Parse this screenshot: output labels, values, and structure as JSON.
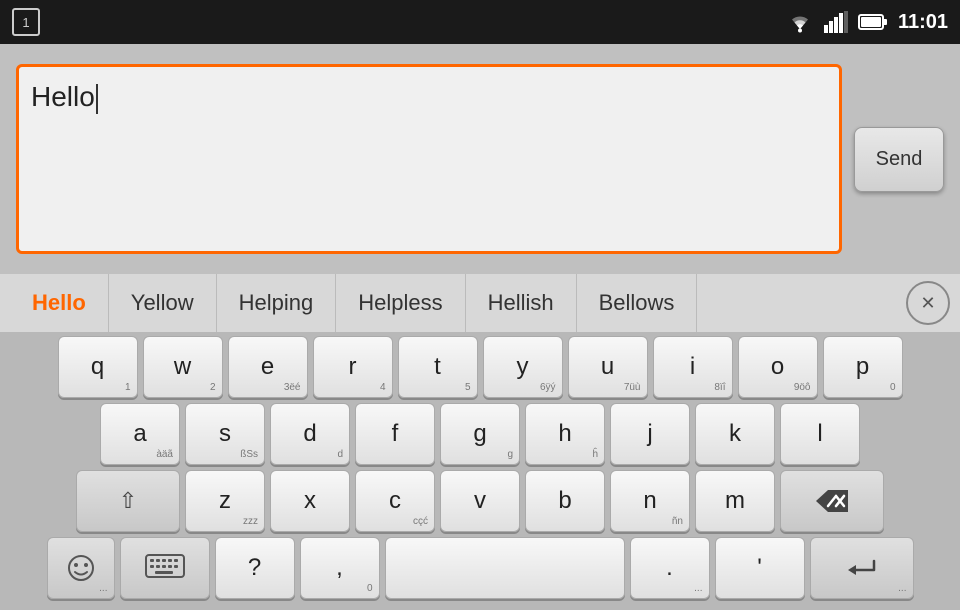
{
  "statusBar": {
    "notificationNum": "1",
    "time": "11:01"
  },
  "textInput": {
    "value": "Hello",
    "placeholder": ""
  },
  "sendButton": {
    "label": "Send"
  },
  "suggestions": [
    {
      "id": "hello",
      "label": "Hello",
      "active": true
    },
    {
      "id": "yellow",
      "label": "Yellow",
      "active": false
    },
    {
      "id": "helping",
      "label": "Helping",
      "active": false
    },
    {
      "id": "helpless",
      "label": "Helpless",
      "active": false
    },
    {
      "id": "hellish",
      "label": "Hellish",
      "active": false
    },
    {
      "id": "bellows",
      "label": "Bellows",
      "active": false
    }
  ],
  "keyboard": {
    "rows": [
      [
        {
          "main": "q",
          "sub": "1"
        },
        {
          "main": "w",
          "sub": "2"
        },
        {
          "main": "e",
          "sub": "3ëé"
        },
        {
          "main": "r",
          "sub": "4"
        },
        {
          "main": "t",
          "sub": "5"
        },
        {
          "main": "y",
          "sub": "6ÿý"
        },
        {
          "main": "u",
          "sub": "7üù"
        },
        {
          "main": "i",
          "sub": "8ïî"
        },
        {
          "main": "o",
          "sub": "9öô"
        },
        {
          "main": "p",
          "sub": "0"
        }
      ],
      [
        {
          "main": "a",
          "sub": "àäã"
        },
        {
          "main": "s",
          "sub": "ßSs"
        },
        {
          "main": "d",
          "sub": "d"
        },
        {
          "main": "f",
          "sub": ""
        },
        {
          "main": "g",
          "sub": "g"
        },
        {
          "main": "h",
          "sub": "h"
        },
        {
          "main": "j",
          "sub": ""
        },
        {
          "main": "k",
          "sub": ""
        },
        {
          "main": "l",
          "sub": ""
        }
      ],
      [
        {
          "main": "shift",
          "sub": ""
        },
        {
          "main": "z",
          "sub": "zzz"
        },
        {
          "main": "x",
          "sub": ""
        },
        {
          "main": "c",
          "sub": "cçć"
        },
        {
          "main": "v",
          "sub": ""
        },
        {
          "main": "b",
          "sub": ""
        },
        {
          "main": "n",
          "sub": "ñn"
        },
        {
          "main": "m",
          "sub": ""
        },
        {
          "main": "delete",
          "sub": ""
        }
      ],
      [
        {
          "main": "emoji",
          "sub": ""
        },
        {
          "main": "keyboard",
          "sub": ""
        },
        {
          "main": "?",
          "sub": ""
        },
        {
          "main": ",",
          "sub": "0"
        },
        {
          "main": "space",
          "sub": ""
        },
        {
          "main": ".",
          "sub": "..."
        },
        {
          "main": "'",
          "sub": ""
        },
        {
          "main": "enter",
          "sub": ""
        }
      ]
    ],
    "shiftLabel": "⇧",
    "deleteLabel": "⌫",
    "enterLabel": "↵"
  }
}
